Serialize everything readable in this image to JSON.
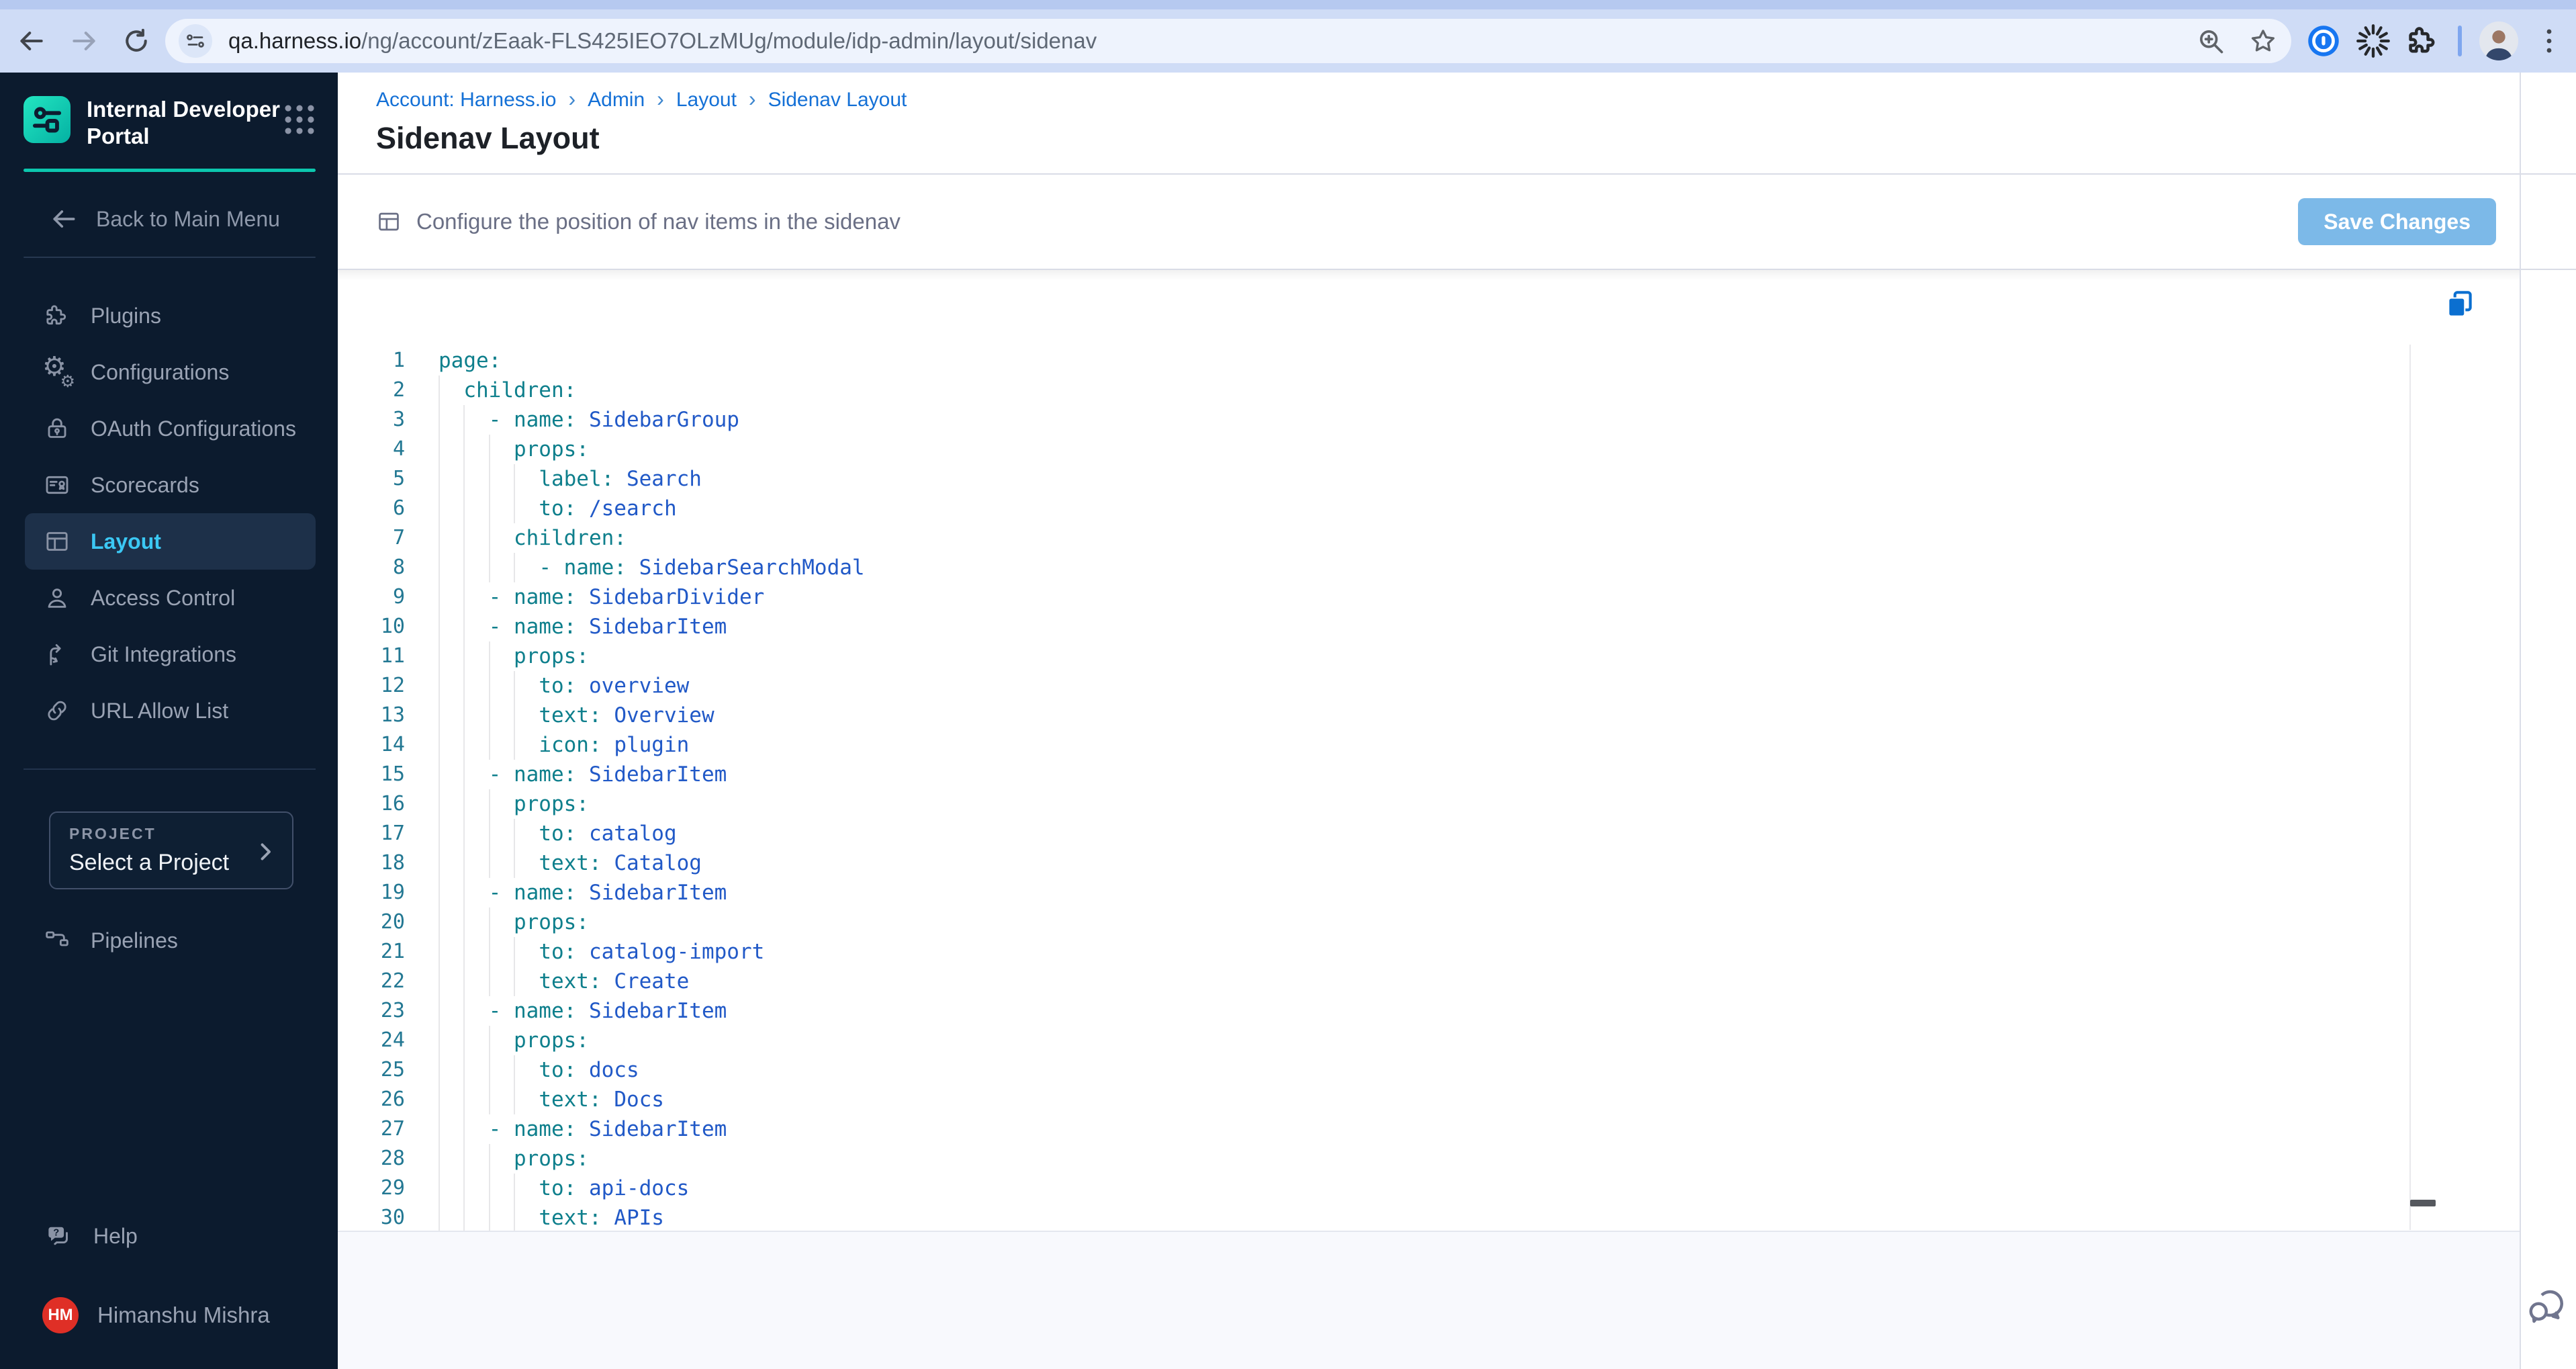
{
  "browser": {
    "url": {
      "domain": "qa.harness.io",
      "path": "/ng/account/zEaak-FLS425IEO7OLzMUg/module/idp-admin/layout/sidenav"
    },
    "icons": [
      "back-icon",
      "forward-icon",
      "reload-icon",
      "site-settings-icon",
      "zoom-icon",
      "bookmark-star-icon",
      "onepassword-extension-icon",
      "loading-extension-icon",
      "extensions-puzzle-icon",
      "profile-avatar",
      "browser-menu-icon"
    ]
  },
  "sidebar": {
    "product_title": "Internal Developer Portal",
    "back_label": "Back to Main Menu",
    "nav_items": [
      {
        "label": "Plugins",
        "icon": "puzzle",
        "selected": false
      },
      {
        "label": "Configurations",
        "icon": "gears",
        "selected": false
      },
      {
        "label": "OAuth Configurations",
        "icon": "lock",
        "selected": false
      },
      {
        "label": "Scorecards",
        "icon": "scorecard",
        "selected": false
      },
      {
        "label": "Layout",
        "icon": "layout",
        "selected": true
      },
      {
        "label": "Access Control",
        "icon": "person",
        "selected": false
      },
      {
        "label": "Git Integrations",
        "icon": "branch",
        "selected": false
      },
      {
        "label": "URL Allow List",
        "icon": "link",
        "selected": false
      }
    ],
    "project": {
      "label": "PROJECT",
      "value": "Select a Project"
    },
    "pipelines_label": "Pipelines",
    "help_label": "Help",
    "user": {
      "name": "Himanshu Mishra",
      "initials": "HM"
    }
  },
  "header": {
    "breadcrumbs": [
      "Account: Harness.io",
      "Admin",
      "Layout",
      "Sidenav Layout"
    ],
    "breadcrumb_separator": "›",
    "title": "Sidenav Layout"
  },
  "configbar": {
    "description": "Configure the position of nav items in the sidenav",
    "save_label": "Save Changes"
  },
  "editor": {
    "language": "yaml",
    "icons": [
      "copy-icon",
      "chat-launcher-icon"
    ],
    "lines": [
      {
        "n": 1,
        "i": 0,
        "d": false,
        "k": "page",
        "v": ""
      },
      {
        "n": 2,
        "i": 2,
        "d": false,
        "k": "children",
        "v": ""
      },
      {
        "n": 3,
        "i": 4,
        "d": true,
        "k": "name",
        "v": "SidebarGroup"
      },
      {
        "n": 4,
        "i": 6,
        "d": false,
        "k": "props",
        "v": ""
      },
      {
        "n": 5,
        "i": 8,
        "d": false,
        "k": "label",
        "v": "Search"
      },
      {
        "n": 6,
        "i": 8,
        "d": false,
        "k": "to",
        "v": "/search"
      },
      {
        "n": 7,
        "i": 6,
        "d": false,
        "k": "children",
        "v": ""
      },
      {
        "n": 8,
        "i": 8,
        "d": true,
        "k": "name",
        "v": "SidebarSearchModal"
      },
      {
        "n": 9,
        "i": 4,
        "d": true,
        "k": "name",
        "v": "SidebarDivider"
      },
      {
        "n": 10,
        "i": 4,
        "d": true,
        "k": "name",
        "v": "SidebarItem"
      },
      {
        "n": 11,
        "i": 6,
        "d": false,
        "k": "props",
        "v": ""
      },
      {
        "n": 12,
        "i": 8,
        "d": false,
        "k": "to",
        "v": "overview"
      },
      {
        "n": 13,
        "i": 8,
        "d": false,
        "k": "text",
        "v": "Overview"
      },
      {
        "n": 14,
        "i": 8,
        "d": false,
        "k": "icon",
        "v": "plugin"
      },
      {
        "n": 15,
        "i": 4,
        "d": true,
        "k": "name",
        "v": "SidebarItem"
      },
      {
        "n": 16,
        "i": 6,
        "d": false,
        "k": "props",
        "v": ""
      },
      {
        "n": 17,
        "i": 8,
        "d": false,
        "k": "to",
        "v": "catalog"
      },
      {
        "n": 18,
        "i": 8,
        "d": false,
        "k": "text",
        "v": "Catalog"
      },
      {
        "n": 19,
        "i": 4,
        "d": true,
        "k": "name",
        "v": "SidebarItem"
      },
      {
        "n": 20,
        "i": 6,
        "d": false,
        "k": "props",
        "v": ""
      },
      {
        "n": 21,
        "i": 8,
        "d": false,
        "k": "to",
        "v": "catalog-import"
      },
      {
        "n": 22,
        "i": 8,
        "d": false,
        "k": "text",
        "v": "Create"
      },
      {
        "n": 23,
        "i": 4,
        "d": true,
        "k": "name",
        "v": "SidebarItem"
      },
      {
        "n": 24,
        "i": 6,
        "d": false,
        "k": "props",
        "v": ""
      },
      {
        "n": 25,
        "i": 8,
        "d": false,
        "k": "to",
        "v": "docs"
      },
      {
        "n": 26,
        "i": 8,
        "d": false,
        "k": "text",
        "v": "Docs"
      },
      {
        "n": 27,
        "i": 4,
        "d": true,
        "k": "name",
        "v": "SidebarItem"
      },
      {
        "n": 28,
        "i": 6,
        "d": false,
        "k": "props",
        "v": ""
      },
      {
        "n": 29,
        "i": 8,
        "d": false,
        "k": "to",
        "v": "api-docs"
      },
      {
        "n": 30,
        "i": 8,
        "d": false,
        "k": "text",
        "v": "APIs"
      }
    ]
  },
  "colors": {
    "sidebar-bg": "#0c1b2e",
    "sidebar-selected-bg": "#1d3049",
    "sidebar-selected-text": "#3bc8f4",
    "sidebar-text": "#9aa3b4",
    "brand-teal": "#0cc7ae",
    "link-blue": "#1470d6",
    "save-button-blue": "#7cb9e8",
    "avatar-red": "#df2f26",
    "code-key": "#0e7f8c",
    "code-value": "#2159c7",
    "code-line-number": "#237893",
    "copy-icon-blue": "#0b6fd0",
    "toolbar-bg": "#cfdcf6",
    "tabstrip-bg": "#b6c9f0",
    "urlbar-bg": "#eef3fd"
  }
}
